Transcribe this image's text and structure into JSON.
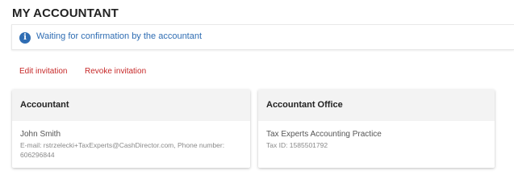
{
  "page": {
    "title": "MY ACCOUNTANT"
  },
  "notice": {
    "icon": "info-icon",
    "icon_glyph": "i",
    "text": "Waiting for confirmation by the accountant",
    "color": "#2f6db3"
  },
  "actions": {
    "edit_label": "Edit invitation",
    "revoke_label": "Revoke invitation",
    "color": "#c62828"
  },
  "accountant_card": {
    "title": "Accountant",
    "name": "John Smith",
    "contact": "E-mail: rstrzelecki+TaxExperts@CashDirector.com, Phone number: 606296844"
  },
  "office_card": {
    "title": "Accountant Office",
    "name": "Tax Experts Accounting Practice",
    "tax_id": "Tax ID: 1585501792"
  }
}
